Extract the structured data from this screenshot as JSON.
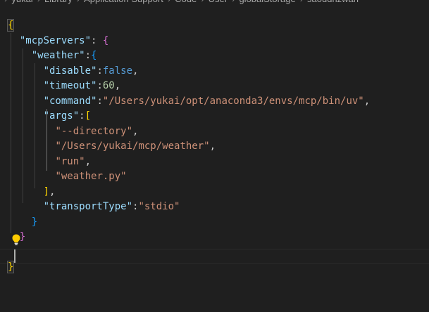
{
  "breadcrumb": {
    "items": [
      "yukai",
      "Library",
      "Application Support",
      "Code",
      "User",
      "globalStorage",
      "saoudrizwan"
    ]
  },
  "editor": {
    "lines": [
      {
        "segments": [
          {
            "t": "{",
            "c": "b1"
          }
        ]
      },
      {
        "segments": [
          {
            "t": "  "
          },
          {
            "t": "\"mcpServers\"",
            "c": "key"
          },
          {
            "t": ": ",
            "c": "pun"
          },
          {
            "t": "{",
            "c": "b2"
          }
        ]
      },
      {
        "segments": [
          {
            "t": "    "
          },
          {
            "t": "\"weather\"",
            "c": "key"
          },
          {
            "t": ":",
            "c": "pun"
          },
          {
            "t": "{",
            "c": "b3"
          }
        ]
      },
      {
        "segments": [
          {
            "t": "      "
          },
          {
            "t": "\"disable\"",
            "c": "key"
          },
          {
            "t": ":",
            "c": "pun"
          },
          {
            "t": "false",
            "c": "kw"
          },
          {
            "t": ",",
            "c": "pun"
          }
        ]
      },
      {
        "segments": [
          {
            "t": "      "
          },
          {
            "t": "\"timeout\"",
            "c": "key"
          },
          {
            "t": ":",
            "c": "pun"
          },
          {
            "t": "60",
            "c": "num"
          },
          {
            "t": ",",
            "c": "pun"
          }
        ]
      },
      {
        "segments": [
          {
            "t": "      "
          },
          {
            "t": "\"command\"",
            "c": "key"
          },
          {
            "t": ":",
            "c": "pun"
          },
          {
            "t": "\"/Users/yukai/opt/anaconda3/envs/mcp/bin/uv\"",
            "c": "str"
          },
          {
            "t": ",",
            "c": "pun"
          }
        ]
      },
      {
        "segments": [
          {
            "t": "      "
          },
          {
            "t": "\"args\"",
            "c": "key"
          },
          {
            "t": ":",
            "c": "pun"
          },
          {
            "t": "[",
            "c": "b1"
          }
        ]
      },
      {
        "segments": [
          {
            "t": "        "
          },
          {
            "t": "\"--directory\"",
            "c": "str"
          },
          {
            "t": ",",
            "c": "pun"
          }
        ]
      },
      {
        "segments": [
          {
            "t": "        "
          },
          {
            "t": "\"/Users/yukai/mcp/weather\"",
            "c": "str"
          },
          {
            "t": ",",
            "c": "pun"
          }
        ]
      },
      {
        "segments": [
          {
            "t": "        "
          },
          {
            "t": "\"run\"",
            "c": "str"
          },
          {
            "t": ",",
            "c": "pun"
          }
        ]
      },
      {
        "segments": [
          {
            "t": "        "
          },
          {
            "t": "\"weather.py\"",
            "c": "str"
          }
        ]
      },
      {
        "segments": [
          {
            "t": "      "
          },
          {
            "t": "]",
            "c": "b1"
          },
          {
            "t": ",",
            "c": "pun"
          }
        ]
      },
      {
        "segments": [
          {
            "t": "      "
          },
          {
            "t": "\"transportType\"",
            "c": "key"
          },
          {
            "t": ":",
            "c": "pun"
          },
          {
            "t": "\"stdio\"",
            "c": "str"
          }
        ]
      },
      {
        "segments": [
          {
            "t": "    "
          },
          {
            "t": "}",
            "c": "b3"
          }
        ]
      },
      {
        "segments": [
          {
            "t": "  "
          },
          {
            "t": "}",
            "c": "b2"
          }
        ]
      },
      {
        "segments": [
          {
            "t": ""
          }
        ]
      },
      {
        "segments": [
          {
            "t": "}",
            "c": "b1"
          }
        ]
      }
    ]
  },
  "colors": {
    "background": "#1f1f1f",
    "key": "#9cdcfe",
    "string": "#ce9178",
    "number": "#b5cea8",
    "keyword": "#569cd6",
    "bracket_level1": "#ffd700",
    "bracket_level2": "#da70d6",
    "bracket_level3": "#179fff",
    "lightbulb": "#ffcc00"
  },
  "icons": {
    "lightbulb": "lightbulb-icon"
  }
}
